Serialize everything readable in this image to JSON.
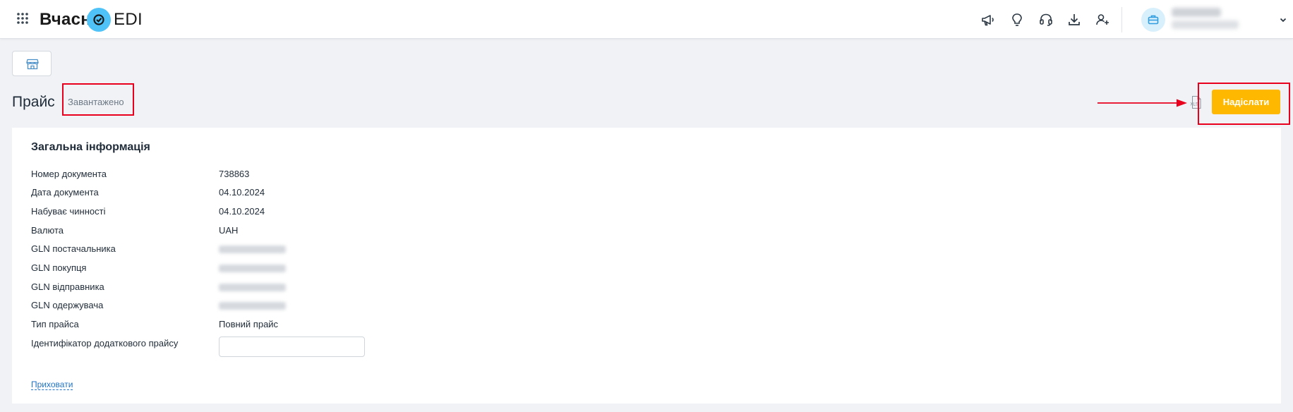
{
  "header": {
    "logo_text_left": "Вчасн",
    "logo_text_right": "EDI",
    "icons": [
      "apps-grid-icon",
      "megaphone-icon",
      "lightbulb-icon",
      "headset-icon",
      "download-icon",
      "add-user-icon",
      "briefcase-icon",
      "chevron-down-icon"
    ]
  },
  "page": {
    "title": "Прайс",
    "status": "Завантажено",
    "send_button": "Надіслати",
    "export_icon": "xls-icon"
  },
  "general_info": {
    "title": "Загальна інформація",
    "rows": [
      {
        "label": "Номер документа",
        "value": "738863"
      },
      {
        "label": "Дата документа",
        "value": "04.10.2024"
      },
      {
        "label": "Набуває чинності",
        "value": "04.10.2024"
      },
      {
        "label": "Валюта",
        "value": "UAH"
      },
      {
        "label": "GLN постачальника",
        "value": ""
      },
      {
        "label": "GLN покупця",
        "value": ""
      },
      {
        "label": "GLN відправника",
        "value": ""
      },
      {
        "label": "GLN одержувача",
        "value": ""
      },
      {
        "label": "Тип прайса",
        "value": "Повний прайс"
      },
      {
        "label": "Ідентифікатор додаткового прайсу",
        "value": ""
      }
    ],
    "hide_link": "Приховати"
  },
  "colors": {
    "accent": "#ffb800",
    "logo_circle": "#4fc3f7",
    "annotation_red": "#e8001c",
    "link": "#1f73c7"
  }
}
